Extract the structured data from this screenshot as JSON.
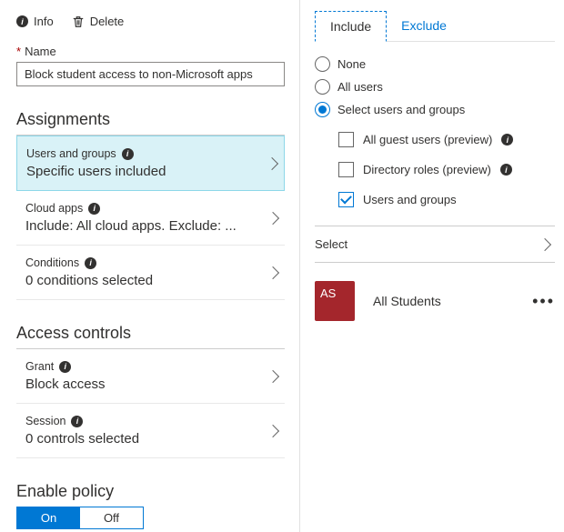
{
  "toolbar": {
    "info_label": "Info",
    "delete_label": "Delete"
  },
  "name_field": {
    "label": "Name",
    "value": "Block student access to non-Microsoft apps"
  },
  "assignments": {
    "title": "Assignments",
    "items": [
      {
        "label": "Users and groups",
        "value": "Specific users included",
        "selected": true
      },
      {
        "label": "Cloud apps",
        "value": "Include: All cloud apps. Exclude: ...",
        "selected": false
      },
      {
        "label": "Conditions",
        "value": "0 conditions selected",
        "selected": false
      }
    ]
  },
  "access_controls": {
    "title": "Access controls",
    "items": [
      {
        "label": "Grant",
        "value": "Block access"
      },
      {
        "label": "Session",
        "value": "0 controls selected"
      }
    ]
  },
  "enable_policy": {
    "title": "Enable policy",
    "on_label": "On",
    "off_label": "Off",
    "value": "On"
  },
  "tabs": {
    "include": "Include",
    "exclude": "Exclude",
    "active": "Include"
  },
  "radios": [
    {
      "label": "None",
      "checked": false
    },
    {
      "label": "All users",
      "checked": false
    },
    {
      "label": "Select users and groups",
      "checked": true
    }
  ],
  "checks": [
    {
      "label": "All guest users (preview)",
      "info": true,
      "checked": false
    },
    {
      "label": "Directory roles (preview)",
      "info": true,
      "checked": false
    },
    {
      "label": "Users and groups",
      "info": false,
      "checked": true
    }
  ],
  "select": {
    "label": "Select"
  },
  "selected_group": {
    "initials": "AS",
    "name": "All Students"
  }
}
